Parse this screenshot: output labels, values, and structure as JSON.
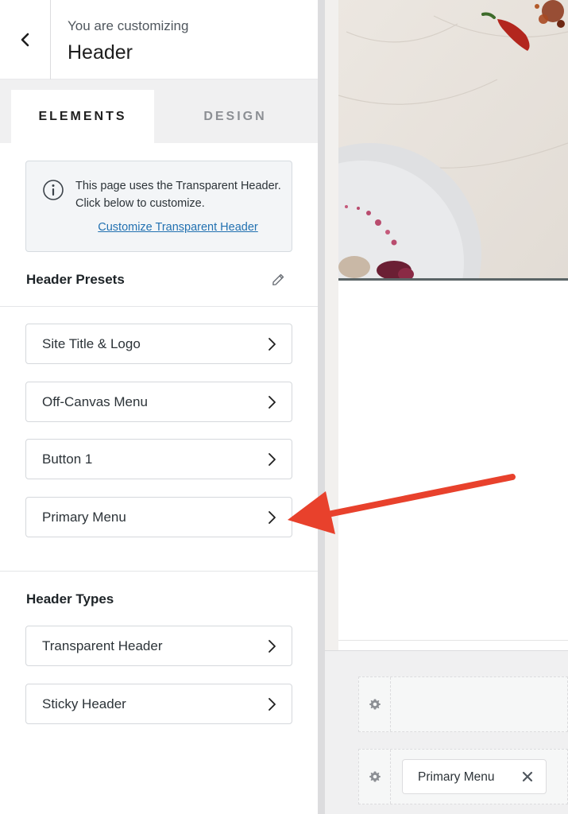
{
  "header": {
    "customizing_label": "You are customizing",
    "title": "Header",
    "back_icon": "chevron-left-icon"
  },
  "tabs": [
    {
      "label": "ELEMENTS",
      "active": true
    },
    {
      "label": "DESIGN",
      "active": false
    }
  ],
  "notice": {
    "icon": "info-icon",
    "text": "This page uses the Transparent Header. Click below to customize.",
    "link": "Customize Transparent Header"
  },
  "presets": {
    "title": "Header Presets",
    "edit_icon": "pencil-icon",
    "items": [
      {
        "label": "Site Title & Logo"
      },
      {
        "label": "Off-Canvas Menu"
      },
      {
        "label": "Button 1"
      },
      {
        "label": "Primary Menu"
      }
    ]
  },
  "types": {
    "title": "Header Types",
    "items": [
      {
        "label": "Transparent Header"
      },
      {
        "label": "Sticky Header"
      }
    ]
  },
  "builder": {
    "row_icon": "gear-icon",
    "chip_label": "Primary Menu",
    "chip_close_icon": "close-icon"
  },
  "colors": {
    "accent": "#2271b1",
    "annotation_arrow": "#e8412c"
  }
}
